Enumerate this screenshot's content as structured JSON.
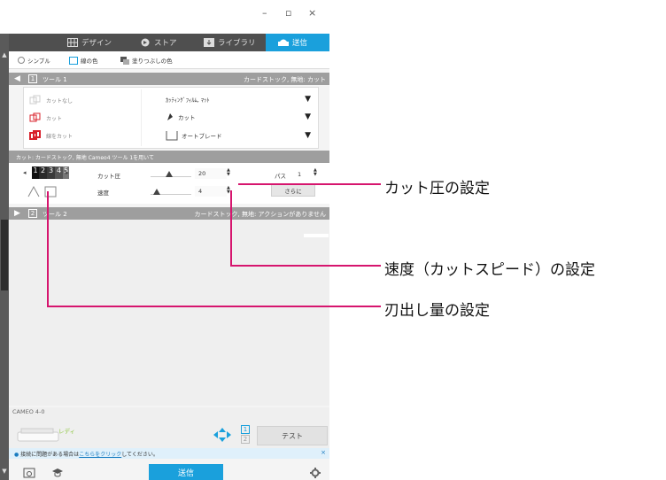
{
  "window": {
    "minimize": "–",
    "maximize": "▫",
    "close": "×"
  },
  "tabs": [
    {
      "label": "デザイン",
      "icon": "grid-icon"
    },
    {
      "label": "ストア",
      "icon": "store-icon"
    },
    {
      "label": "ライブラリ",
      "icon": "library-icon"
    },
    {
      "label": "送信",
      "icon": "send-icon",
      "active": true
    }
  ],
  "modes": [
    {
      "label": "シンプル"
    },
    {
      "label": "線の色"
    },
    {
      "label": "塗りつぶしの色"
    }
  ],
  "tool1": {
    "num": "1",
    "name": "ツール 1",
    "status": "カードストック, 無地: カット"
  },
  "cut_options": [
    {
      "label": "カットなし"
    },
    {
      "label": "カット"
    },
    {
      "label": "線をカット"
    }
  ],
  "material": "ｶｯﾃｨﾝｸﾞﾌｨﾙﾑ, ﾏｯﾄ",
  "action": "カット",
  "blade": "オートブレード",
  "blade_bar": "カット: カードストック, 無地 Cameo4 ツール 1を用いて",
  "blade_digits": [
    "1",
    "2",
    "3",
    "4",
    "5"
  ],
  "params": {
    "force_label": "カット圧",
    "force_value": "20",
    "force_level": 0.45,
    "speed_label": "速度",
    "speed_value": "4",
    "speed_level": 0.08,
    "pass_label": "パス",
    "pass_value": "1",
    "more_label": "さらに"
  },
  "tool2": {
    "num": "2",
    "name": "ツール 2",
    "status": "カードストック, 無地: アクションがありません"
  },
  "device": {
    "name": "CAMEO 4-0",
    "status": "レディ",
    "test_label": "テスト",
    "nums": [
      "1",
      "2"
    ]
  },
  "infobar": {
    "prefix": "接続に問題がある場合は",
    "link": "こちらをクリック",
    "suffix": "してください。",
    "close": "×"
  },
  "send_label": "送信",
  "annotations": {
    "force": "カット圧の設定",
    "speed": "速度（カットスピード）の設定",
    "depth": "刃出し量の設定"
  },
  "colors": {
    "accent": "#1aa0dc",
    "callout": "#d6156e",
    "header": "#9e9e9e",
    "tabbar": "#4f4f4f",
    "ready": "#8cc63e"
  }
}
